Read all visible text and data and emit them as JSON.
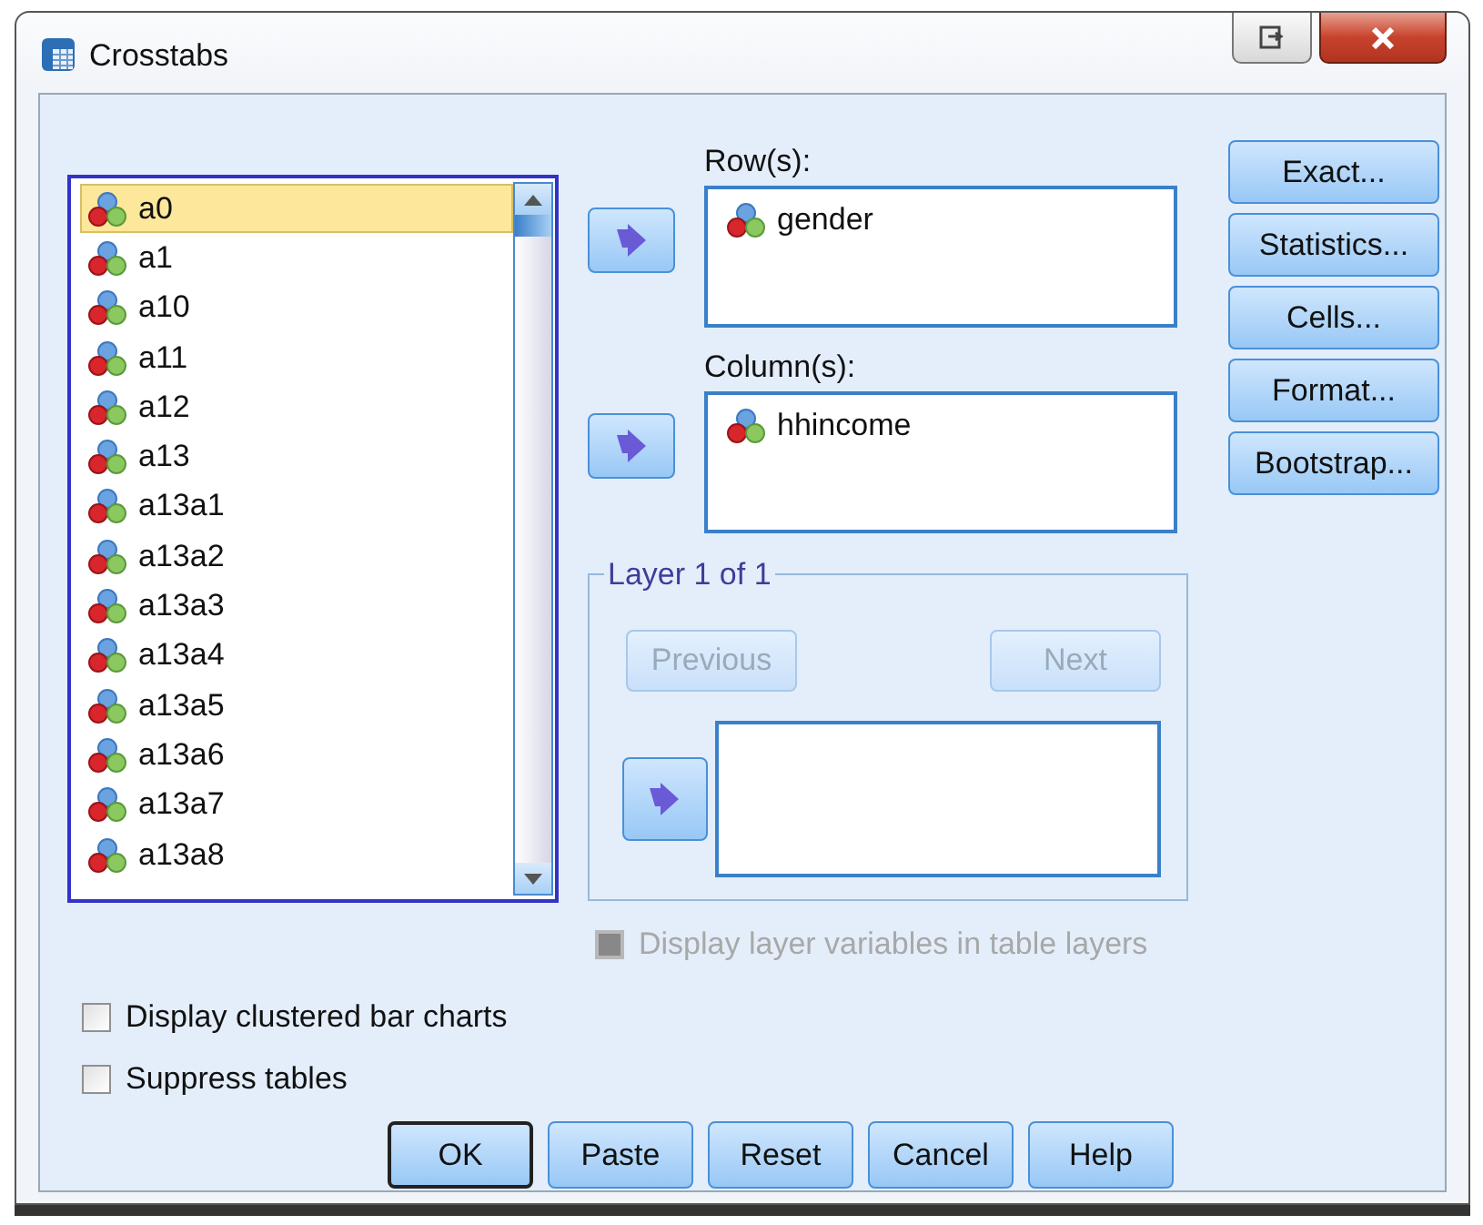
{
  "window": {
    "title": "Crosstabs"
  },
  "variables": {
    "items": [
      {
        "label": "a0",
        "selected": true
      },
      {
        "label": "a1",
        "selected": false
      },
      {
        "label": "a10",
        "selected": false
      },
      {
        "label": "a11",
        "selected": false
      },
      {
        "label": "a12",
        "selected": false
      },
      {
        "label": "a13",
        "selected": false
      },
      {
        "label": "a13a1",
        "selected": false
      },
      {
        "label": "a13a2",
        "selected": false
      },
      {
        "label": "a13a3",
        "selected": false
      },
      {
        "label": "a13a4",
        "selected": false
      },
      {
        "label": "a13a5",
        "selected": false
      },
      {
        "label": "a13a6",
        "selected": false
      },
      {
        "label": "a13a7",
        "selected": false
      },
      {
        "label": "a13a8",
        "selected": false
      }
    ]
  },
  "rows": {
    "label": "Row(s):",
    "items": [
      "gender"
    ]
  },
  "columns": {
    "label": "Column(s):",
    "items": [
      "hhincome"
    ]
  },
  "layer": {
    "title": "Layer 1 of 1",
    "previous": {
      "label": "Previous",
      "disabled": true
    },
    "next": {
      "label": "Next",
      "disabled": true
    }
  },
  "display_layer_variables": {
    "label": "Display layer variables in table layers",
    "checked": false,
    "disabled": true
  },
  "options": [
    {
      "label": "Display clustered bar charts",
      "checked": false
    },
    {
      "label": "Suppress tables",
      "checked": false
    }
  ],
  "side_buttons": [
    {
      "label": "Exact..."
    },
    {
      "label": "Statistics..."
    },
    {
      "label": "Cells..."
    },
    {
      "label": "Format..."
    },
    {
      "label": "Bootstrap..."
    }
  ],
  "buttons": [
    {
      "label": "OK",
      "default": true
    },
    {
      "label": "Paste",
      "default": false
    },
    {
      "label": "Reset",
      "default": false
    },
    {
      "label": "Cancel",
      "default": false
    },
    {
      "label": "Help",
      "default": false
    }
  ]
}
